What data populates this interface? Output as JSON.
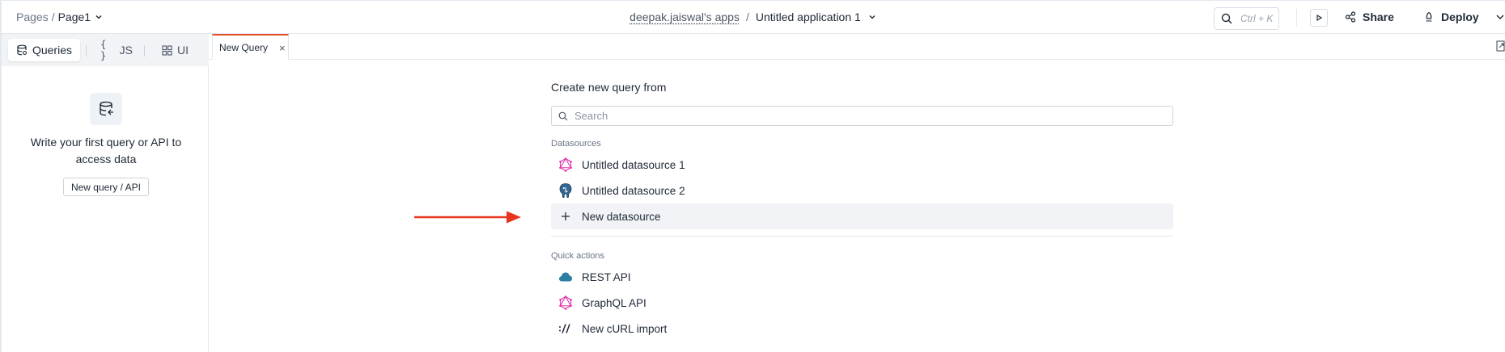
{
  "header": {
    "breadcrumb_root": "Pages",
    "breadcrumb_sep": "/",
    "breadcrumb_page": "Page1",
    "workspace": "deepak.jaiswal's apps",
    "title_sep": "/",
    "app_name": "Untitled application 1",
    "search_hint": "Ctrl + K",
    "share_label": "Share",
    "deploy_label": "Deploy"
  },
  "sidebar": {
    "tabs": [
      {
        "label": "Queries",
        "icon": "database-icon"
      },
      {
        "label": "JS",
        "icon": "braces-icon"
      },
      {
        "label": "UI",
        "icon": "widgets-icon"
      }
    ],
    "empty_text": "Write your first query or API to access data",
    "new_button": "New query / API"
  },
  "tabbar": {
    "tab_label": "New Query",
    "close_glyph": "×"
  },
  "main": {
    "title": "Create new query from",
    "search_placeholder": "Search",
    "datasources_label": "Datasources",
    "datasources": [
      {
        "label": "Untitled datasource 1",
        "icon": "graphql-icon"
      },
      {
        "label": "Untitled datasource 2",
        "icon": "postgres-icon"
      }
    ],
    "new_datasource": "New datasource",
    "quick_actions_label": "Quick actions",
    "quick_actions": [
      {
        "label": "REST API",
        "icon": "cloud-icon"
      },
      {
        "label": "GraphQL API",
        "icon": "graphql-icon"
      },
      {
        "label": "New cURL import",
        "icon": "curl-icon"
      }
    ]
  },
  "colors": {
    "accent": "#e6512b",
    "arrow": "#e8361e",
    "graphql": "#e535ab",
    "cloud": "#2d7ea3"
  }
}
